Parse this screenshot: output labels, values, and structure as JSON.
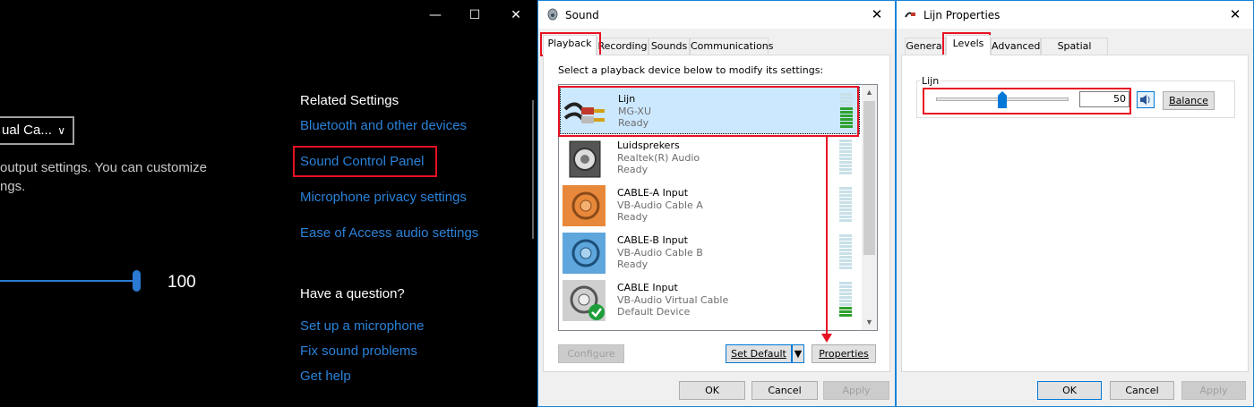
{
  "settings": {
    "window_controls": {
      "minimize": "—",
      "maximize": "☐",
      "close": "✕"
    },
    "device_dropdown": {
      "value": "ual Ca...",
      "chevron": "chevron-down-icon"
    },
    "description_line1": "output settings. You can customize",
    "description_line2": "ngs.",
    "volume": {
      "value": "100",
      "fraction": 1.0
    },
    "related_heading": "Related Settings",
    "related_links": [
      "Bluetooth and other devices",
      "Sound Control Panel",
      "Microphone privacy settings",
      "Ease of Access audio settings"
    ],
    "question_heading": "Have a question?",
    "help_links": [
      "Set up a microphone",
      "Fix sound problems",
      "Get help"
    ],
    "link_color": "#2a82d8"
  },
  "sound_dialog": {
    "title": "Sound",
    "close": "✕",
    "tabs": [
      "Playback",
      "Recording",
      "Sounds",
      "Communications"
    ],
    "prompt": "Select a playback device below to modify its settings:",
    "devices": [
      {
        "name": "Lijn",
        "line2": "MG-XU",
        "line3": "Ready",
        "icon": "audio-cable-icon",
        "level": 0.55
      },
      {
        "name": "Luidsprekers",
        "line2": "Realtek(R) Audio",
        "line3": "Ready",
        "icon": "speaker-icon",
        "level": 0
      },
      {
        "name": "CABLE-A Input",
        "line2": "VB-Audio Cable A",
        "line3": "Ready",
        "icon": "cable-a-icon",
        "level": 0
      },
      {
        "name": "CABLE-B Input",
        "line2": "VB-Audio Cable B",
        "line3": "Ready",
        "icon": "cable-b-icon",
        "level": 0
      },
      {
        "name": "CABLE Input",
        "line2": "VB-Audio Virtual Cable",
        "line3": "Default Device",
        "icon": "cable-input-icon",
        "level": 0.3
      }
    ],
    "buttons": {
      "configure": "Configure",
      "set_default": "Set Default",
      "properties": "Properties",
      "ok": "OK",
      "cancel": "Cancel",
      "apply": "Apply"
    }
  },
  "props_dialog": {
    "title": "Lijn Properties",
    "close": "✕",
    "tabs": [
      "General",
      "Levels",
      "Advanced",
      "Spatial sound"
    ],
    "group_label": "Lijn",
    "level_value": "50",
    "level_fraction": 0.5,
    "buttons": {
      "balance": "Balance",
      "ok": "OK",
      "cancel": "Cancel",
      "apply": "Apply"
    }
  },
  "colors": {
    "highlight": "#e81123",
    "accent": "#0078d7"
  }
}
